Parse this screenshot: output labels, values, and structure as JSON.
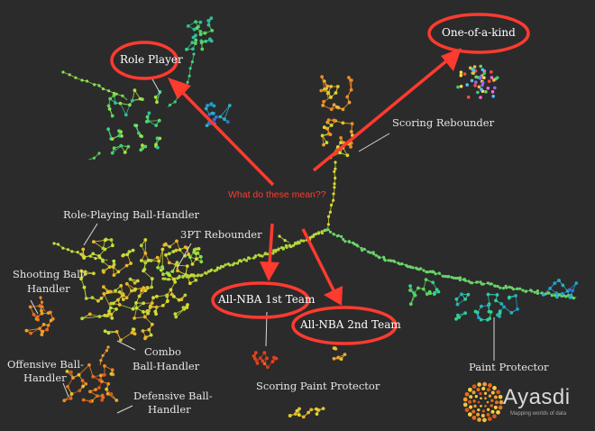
{
  "labels": {
    "role_player": "Role Player",
    "one_of_a_kind": "One-of-a-kind",
    "scoring_rebounder": "Scoring Rebounder",
    "question": "What do these mean??",
    "role_playing_ball_handler": "Role-Playing Ball-Handler",
    "three_pt_rebounder": "3PT Rebounder",
    "shooting_ball_handler_1": "Shooting Ball-",
    "shooting_ball_handler_2": "Handler",
    "all_nba_1st": "All-NBA 1st Team",
    "all_nba_2nd": "All-NBA 2nd Team",
    "combo_ball_handler_1": "Combo",
    "combo_ball_handler_2": "Ball-Handler",
    "offensive_ball_handler_1": "Offensive Ball-",
    "offensive_ball_handler_2": "Handler",
    "paint_protector": "Paint Protector",
    "defensive_ball_handler_1": "Defensive Ball-",
    "defensive_ball_handler_2": "Handler",
    "scoring_paint_protector": "Scoring Paint Protector"
  },
  "brand": {
    "name": "Ayasdi",
    "tagline": "Mapping worlds of data"
  },
  "colors": {
    "background": "#2b2b2b",
    "annotation_red": "#ff3b30",
    "label": "#e6e6e6"
  }
}
